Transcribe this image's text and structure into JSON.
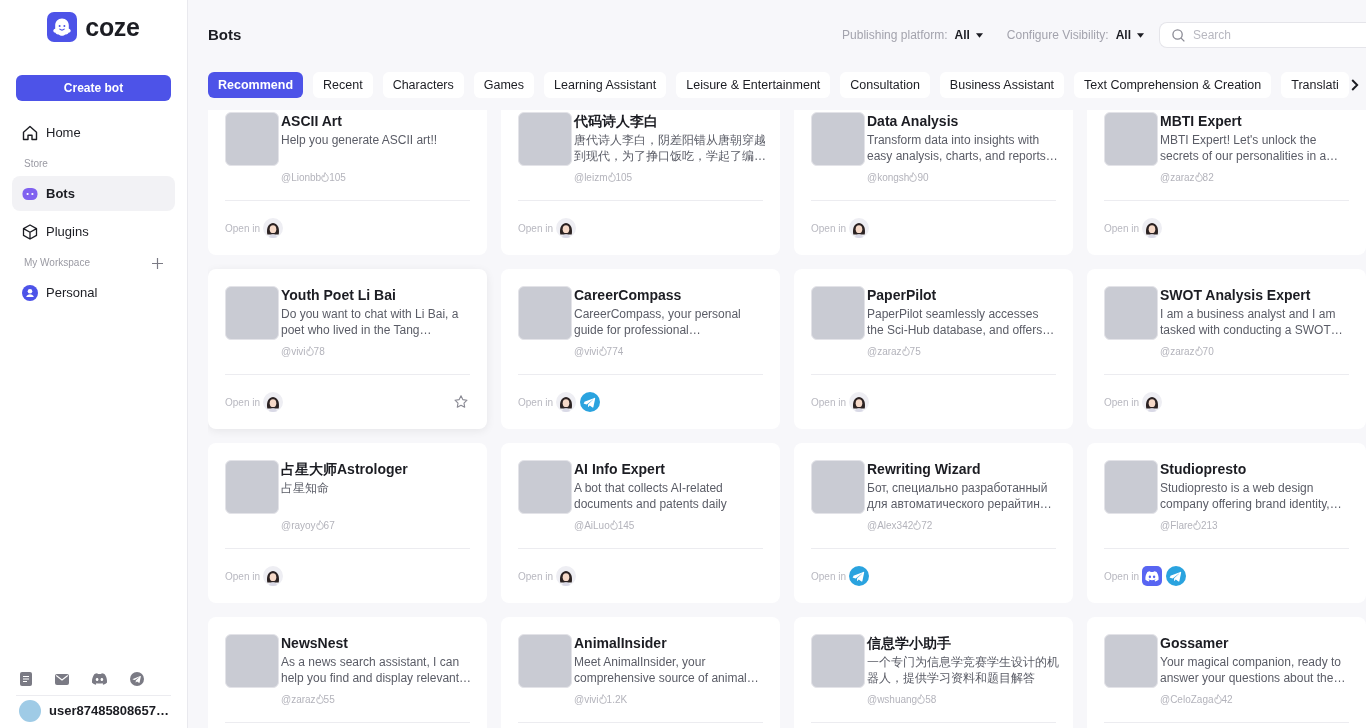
{
  "sidebar": {
    "logo": "coze",
    "create_button": "Create bot",
    "nav": [
      {
        "kind": "item",
        "label": "Home",
        "selected": false
      },
      {
        "kind": "heading",
        "label": "Store",
        "addable": false
      },
      {
        "kind": "item",
        "label": "Bots",
        "selected": true
      },
      {
        "kind": "item",
        "label": "Plugins",
        "selected": false
      },
      {
        "kind": "heading",
        "label": "My Workspace",
        "addable": true
      },
      {
        "kind": "item",
        "label": "Personal",
        "selected": false
      }
    ],
    "user": {
      "name": "user87485808657…"
    }
  },
  "header": {
    "title": "Bots",
    "filters": [
      {
        "label": "Publishing platform:",
        "value": "All"
      },
      {
        "label": "Configure Visibility:",
        "value": "All"
      }
    ],
    "search": {
      "placeholder": "Search"
    }
  },
  "tabs": [
    {
      "label": "Recommend",
      "selected": true
    },
    {
      "label": "Recent",
      "selected": false
    },
    {
      "label": "Characters",
      "selected": false
    },
    {
      "label": "Games",
      "selected": false
    },
    {
      "label": "Learning Assistant",
      "selected": false
    },
    {
      "label": "Leisure & Entertainment",
      "selected": false
    },
    {
      "label": "Consultation",
      "selected": false
    },
    {
      "label": "Business Assistant",
      "selected": false
    },
    {
      "label": "Text Comprehension & Creation",
      "selected": false
    },
    {
      "label": "Translati",
      "selected": false
    }
  ],
  "bots": [
    {
      "name": "ASCII Art",
      "description": "Help you generate ASCII art!!",
      "author": "@Lionbb",
      "likes": "105",
      "open_label": "Open in",
      "platforms": [
        {
          "kind": "avatar"
        }
      ],
      "hovered": false
    },
    {
      "name": "代码诗人李白",
      "description": "唐代诗人李白，阴差阳错从唐朝穿越到现代，为了挣口饭吃，学起了编…",
      "author": "@leizm",
      "likes": "105",
      "open_label": "Open in",
      "platforms": [
        {
          "kind": "avatar"
        }
      ],
      "hovered": false
    },
    {
      "name": "Data Analysis",
      "description": "Transform data into insights with\neasy analysis, charts, and reports…",
      "author": "@kongsh",
      "likes": "90",
      "open_label": "Open in",
      "platforms": [
        {
          "kind": "avatar"
        }
      ],
      "hovered": false
    },
    {
      "name": "MBTI Expert",
      "description": "MBTI Expert! Let's unlock the\nsecrets of our personalities in a…",
      "author": "@zaraz",
      "likes": "82",
      "open_label": "Open in",
      "platforms": [
        {
          "kind": "avatar"
        }
      ],
      "hovered": false
    },
    {
      "name": "Youth Poet Li Bai",
      "description": "Do you want to chat with Li Bai, a\npoet who lived in the Tang…",
      "author": "@vivi",
      "likes": "78",
      "open_label": "Open in",
      "platforms": [
        {
          "kind": "avatar"
        }
      ],
      "hovered": true
    },
    {
      "name": "CareerCompass",
      "description": "CareerCompass, your personal\nguide for professional…",
      "author": "@vivi",
      "likes": "774",
      "open_label": "Open in",
      "platforms": [
        {
          "kind": "avatar"
        },
        {
          "kind": "telegram"
        }
      ],
      "hovered": false
    },
    {
      "name": "PaperPilot",
      "description": "PaperPilot seamlessly accesses\nthe Sci-Hub database, and offers…",
      "author": "@zaraz",
      "likes": "75",
      "open_label": "Open in",
      "platforms": [
        {
          "kind": "avatar"
        }
      ],
      "hovered": false
    },
    {
      "name": "SWOT Analysis Expert",
      "description": "I am a business analyst and I am\ntasked with conducting a SWOT…",
      "author": "@zaraz",
      "likes": "70",
      "open_label": "Open in",
      "platforms": [
        {
          "kind": "avatar"
        }
      ],
      "hovered": false
    },
    {
      "name": "占星大师Astrologer",
      "description": "占星知命",
      "author": "@rayoy",
      "likes": "67",
      "open_label": "Open in",
      "platforms": [
        {
          "kind": "avatar"
        }
      ],
      "hovered": false
    },
    {
      "name": "AI Info Expert",
      "description": "A bot that collects AI-related\ndocuments and patents daily",
      "author": "@AiLuo",
      "likes": "145",
      "open_label": "Open in",
      "platforms": [
        {
          "kind": "avatar"
        }
      ],
      "hovered": false
    },
    {
      "name": "Rewriting Wizard",
      "description": "Бот, специально разработанный\nдля автоматического рерайтин…",
      "author": "@Alex342",
      "likes": "72",
      "open_label": "Open in",
      "platforms": [
        {
          "kind": "telegram"
        }
      ],
      "hovered": false
    },
    {
      "name": "Studiopresto",
      "description": "Studiopresto is a web design\ncompany offering brand identity,…",
      "author": "@Flare",
      "likes": "213",
      "open_label": "Open in",
      "platforms": [
        {
          "kind": "discord"
        },
        {
          "kind": "telegram"
        }
      ],
      "hovered": false
    },
    {
      "name": "NewsNest",
      "description": "As a news search assistant, I can\nhelp you find and display relevant…",
      "author": "@zaraz",
      "likes": "55"
    },
    {
      "name": "AnimalInsider",
      "description": "Meet AnimalInsider, your\ncomprehensive source of animal…",
      "author": "@vivi",
      "likes": "1.2K"
    },
    {
      "name": "信息学小助手",
      "description": "一个专门为信息学竞赛学生设计的机器人，提供学习资料和题目解答",
      "author": "@wshuang",
      "likes": "58"
    },
    {
      "name": "Gossamer",
      "description": "Your magical companion, ready to\nanswer your questions about the…",
      "author": "@CeloZaga",
      "likes": "42"
    }
  ]
}
